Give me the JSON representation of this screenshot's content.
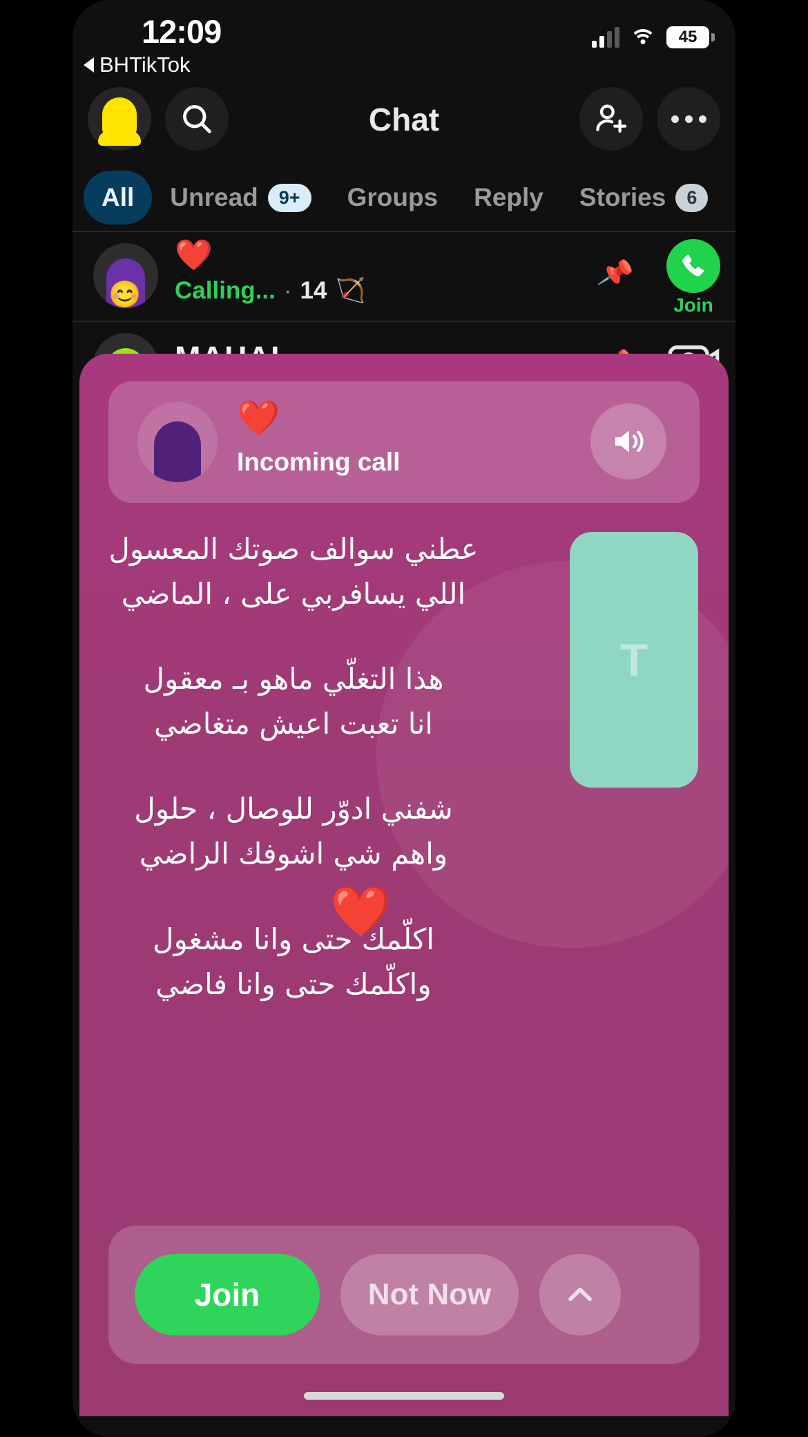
{
  "status_bar": {
    "time": "12:09",
    "back_app": "BHTikTok",
    "battery_level": "45",
    "signal_icon": "cellular-bars-icon",
    "wifi_icon": "wifi-icon",
    "battery_icon": "battery-icon"
  },
  "header": {
    "title": "Chat",
    "avatar_icon": "bitmoji-avatar-icon",
    "search_icon": "search-icon",
    "add_friend_icon": "add-friend-icon",
    "more_icon": "more-options-icon"
  },
  "tabs": [
    {
      "label": "All",
      "badge": "",
      "active": true
    },
    {
      "label": "Unread",
      "badge": "9+",
      "active": false
    },
    {
      "label": "Groups",
      "badge": "",
      "active": false
    },
    {
      "label": "Reply",
      "badge": "",
      "active": false
    },
    {
      "label": "Stories",
      "badge": "6",
      "active": false
    }
  ],
  "chat_rows": [
    {
      "name_emoji": "❤️",
      "status": "Calling...",
      "separator": "·",
      "streak_count": "14",
      "streak_emoji": "🏹",
      "avatar_emoji": "😊",
      "pin_icon": "pin-icon",
      "action_label": "Join",
      "action_icon": "phone-icon"
    },
    {
      "name": "MAHAL",
      "pin_icon": "pin-icon",
      "action_icon": "camera-icon"
    }
  ],
  "call_modal": {
    "caller_emoji": "❤️",
    "caller_status": "Incoming call",
    "caller_avatar_icon": "person-avatar-icon",
    "speaker_icon": "speaker-loud-icon",
    "participant_tile_initial": "T",
    "heart_overlay": "❤️",
    "lyrics": [
      [
        "عطني سوالف صوتك المعسول",
        "اللي يسافربي على ، الماضي"
      ],
      [
        "هذا التغلّي ماهو بـ معقول",
        "انا تعبت اعيش متغاضي"
      ],
      [
        "شفني ادوّر للوصال ، حلول",
        "واهم شي اشوفك الراضي"
      ],
      [
        "اكلّمك حتى وانا مشغول",
        "واكلّمك حتى وانا فاضي"
      ]
    ],
    "join_label": "Join",
    "not_now_label": "Not Now",
    "expand_icon": "chevron-up-icon"
  },
  "colors": {
    "modal_bg": "#a1397a",
    "accent_green": "#2fd55a",
    "tab_active_bg": "#063c5e",
    "tile_bg": "#8fd6c3",
    "bitmoji_yellow": "#ffe400"
  }
}
